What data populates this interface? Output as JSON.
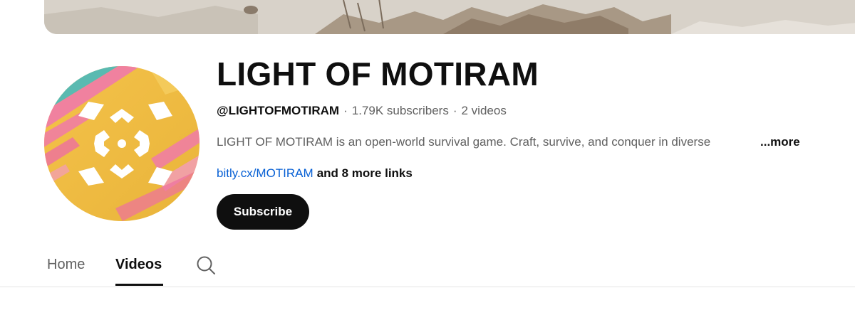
{
  "channel": {
    "name": "LIGHT OF MOTIRAM",
    "handle": "@LIGHTOFMOTIRAM",
    "subscribers": "1.79K subscribers",
    "videos": "2 videos",
    "separator": "·",
    "description": "LIGHT OF MOTIRAM is an open-world survival game. Craft, survive, and conquer in diverse",
    "more_label": "...more",
    "link_text": "bitly.cx/MOTIRAM",
    "more_links_label": "and 8 more links",
    "subscribe_label": "Subscribe"
  },
  "tabs": [
    {
      "label": "Home",
      "selected": false
    },
    {
      "label": "Videos",
      "selected": true
    }
  ],
  "icons": {
    "search": "search-icon",
    "avatar": "channel-logo"
  },
  "colors": {
    "link": "#065fd4",
    "subscribe_bg": "#0f0f0f",
    "secondary_text": "#606060"
  }
}
